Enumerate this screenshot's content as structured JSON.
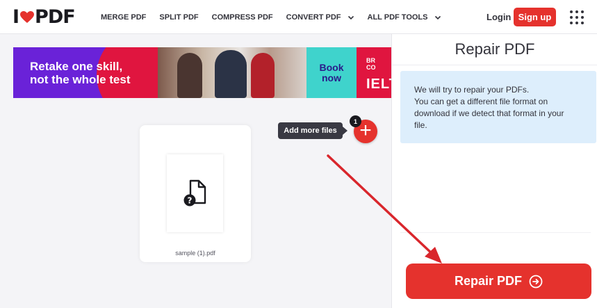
{
  "header": {
    "logo": {
      "prefix": "I",
      "suffix": "PDF"
    },
    "nav": [
      {
        "label": "MERGE PDF",
        "dropdown": false
      },
      {
        "label": "SPLIT PDF",
        "dropdown": false
      },
      {
        "label": "COMPRESS PDF",
        "dropdown": false
      },
      {
        "label": "CONVERT PDF",
        "dropdown": true
      },
      {
        "label": "ALL PDF TOOLS",
        "dropdown": true
      }
    ],
    "login_label": "Login",
    "signup_label": "Sign up"
  },
  "ad": {
    "headline_line1": "Retake one skill,",
    "headline_line2": "not the whole test",
    "cta_line1": "Book",
    "cta_line2": "now",
    "brand_top_line1": "BR",
    "brand_top_line2": "CO",
    "brand_bottom": "IELT"
  },
  "workspace": {
    "file": {
      "name": "sample (1).pdf",
      "icon": "unknown-file-icon"
    },
    "add_tooltip": "Add more files",
    "file_count": "1"
  },
  "sidebar": {
    "title": "Repair PDF",
    "info_line1": "We will try to repair your PDFs.",
    "info_line2": "You can get a different file format on",
    "info_line3": "download if we detect that format in your",
    "info_line4": "file.",
    "action_label": "Repair PDF"
  },
  "colors": {
    "brand_red": "#e5322d",
    "info_bg": "#ddeefc",
    "annotation_arrow": "#d9262c"
  }
}
